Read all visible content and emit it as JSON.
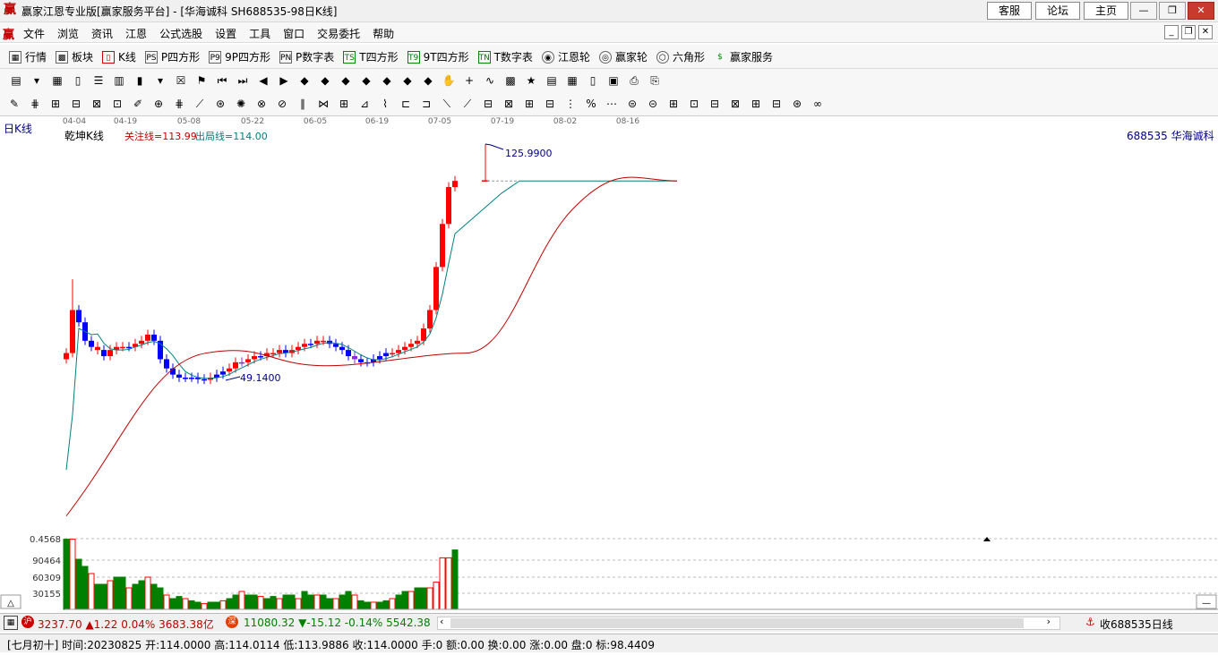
{
  "window": {
    "title": "赢家江恩专业版[赢家服务平台] - [华海诚科  SH688535-98日K线]",
    "logo": "赢",
    "links": [
      "客服",
      "论坛",
      "主页"
    ]
  },
  "menu": {
    "items": [
      "文件",
      "浏览",
      "资讯",
      "江恩",
      "公式选股",
      "设置",
      "工具",
      "窗口",
      "交易委托",
      "帮助"
    ]
  },
  "toolbar": {
    "items": [
      {
        "label": "行情",
        "icon": "table-icon"
      },
      {
        "label": "板块",
        "icon": "grid-icon"
      },
      {
        "label": "K线",
        "icon": "candle-icon"
      },
      {
        "label": "P四方形",
        "icon": "ps-icon",
        "badge": "PS"
      },
      {
        "label": "9P四方形",
        "icon": "p9-icon",
        "badge": "P9"
      },
      {
        "label": "P数字表",
        "icon": "pn-icon",
        "badge": "PN"
      },
      {
        "label": "T四方形",
        "icon": "ts-icon",
        "badge": "TS"
      },
      {
        "label": "9T四方形",
        "icon": "t9-icon",
        "badge": "T9"
      },
      {
        "label": "T数字表",
        "icon": "tn-icon",
        "badge": "TN"
      },
      {
        "label": "江恩轮",
        "icon": "wheel-icon"
      },
      {
        "label": "赢家轮",
        "icon": "wheel2-icon"
      },
      {
        "label": "六角形",
        "icon": "hexagon-icon"
      },
      {
        "label": "赢家服务",
        "icon": "dollar-icon"
      }
    ]
  },
  "chart": {
    "period_label": "日K线",
    "indicator_name": "乾坤K线",
    "attention_line": "关注线=113.99",
    "exit_line": "出局线=114.00",
    "stock_label": "688535  华海诚科",
    "high_label": "125.9900",
    "low_label": "49.1400",
    "date_ticks": [
      "04-04",
      "04-19",
      "05-08",
      "05-22",
      "06-05",
      "06-19",
      "07-05",
      "07-19",
      "08-02",
      "08-16"
    ],
    "volume_labels": [
      "0.4568",
      "90464",
      "60309",
      "30155"
    ],
    "colors": {
      "up": "#ff0000",
      "down": "#0000ff",
      "vol_up": "#ff0000",
      "vol_down": "#008000",
      "line_fast": "#008080",
      "line_slow": "#c00000"
    }
  },
  "chart_data": {
    "type": "candlestick",
    "x": [
      "04-04",
      "04-19",
      "05-08",
      "05-22",
      "06-05",
      "06-19",
      "07-05",
      "07-19"
    ],
    "high": 125.99,
    "low": 49.14,
    "attention_line": 113.99,
    "exit_line": 114.0
  },
  "index_bar": {
    "sh_badge": "沪",
    "sh_text": "3237.70 ▲1.22 0.04% 3683.38亿",
    "sz_badge": "深",
    "sz_text": "11080.32 ▼-15.12 -0.14% 5542.38",
    "right_text": "收688535日线"
  },
  "status": {
    "text": "[七月初十] 时间:20230825 开:114.0000 高:114.0114 低:113.9886 收:114.0000 手:0 额:0.00 换:0.00 涨:0.00 盘:0 标:98.4409"
  }
}
